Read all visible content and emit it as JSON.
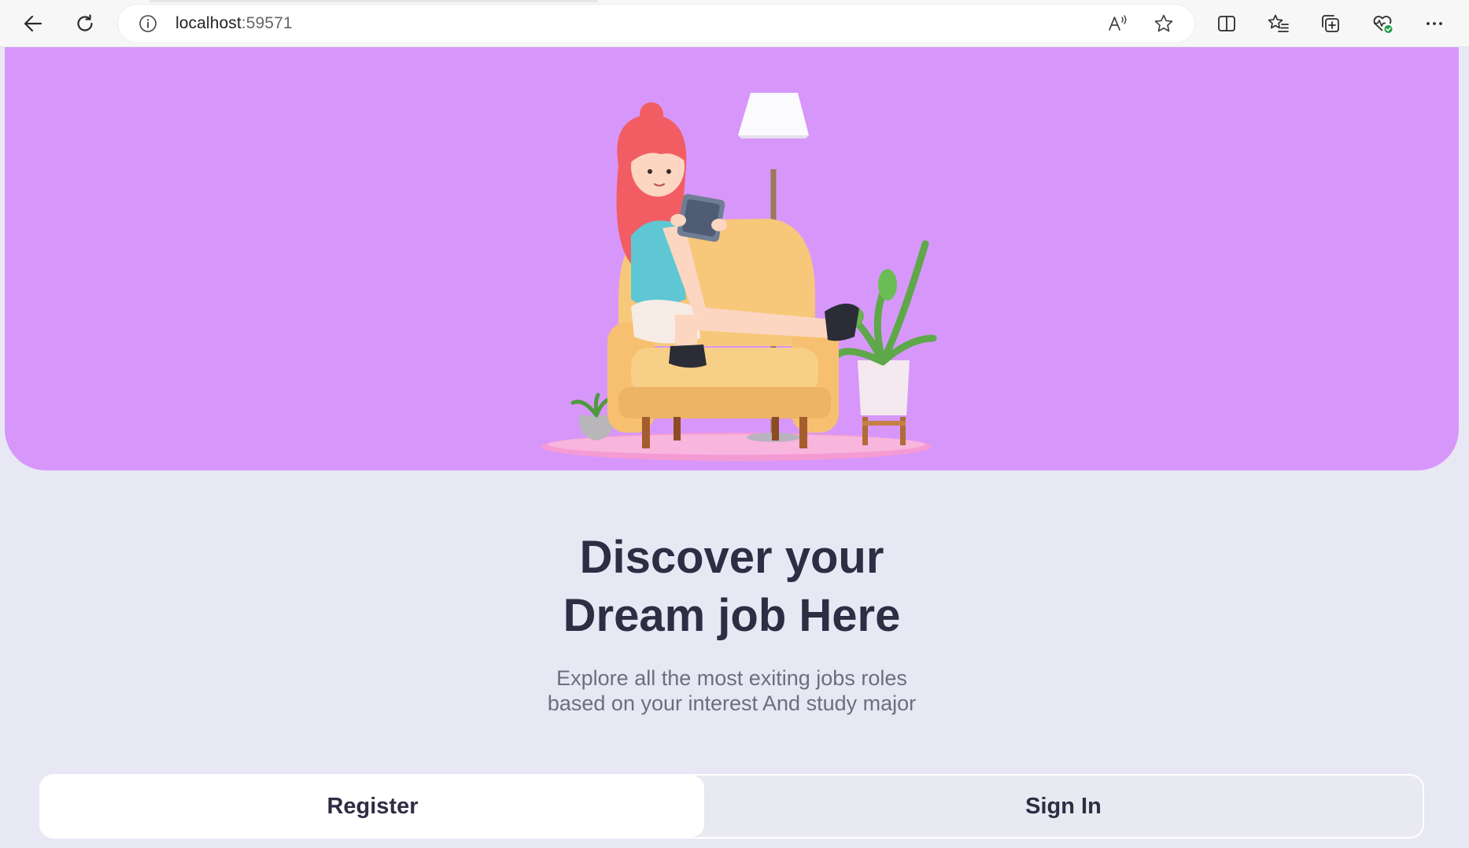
{
  "browser": {
    "url_host": "localhost",
    "url_port": ":59571",
    "icons": {
      "back": "back-arrow-icon",
      "reload": "reload-icon",
      "site_info": "info-icon",
      "read_aloud": "read-aloud-icon",
      "favorite": "star-icon",
      "split_screen": "split-screen-icon",
      "favorites": "favorites-list-icon",
      "collections": "collections-icon",
      "health": "browser-essentials-icon",
      "menu": "more-icon"
    }
  },
  "hero": {
    "background_color": "#d797fa",
    "illustration": "girl-on-armchair-with-tablet"
  },
  "headline": {
    "line1": "Discover your",
    "line2": "Dream job Here"
  },
  "subtitle": {
    "line1": "Explore all the most exiting jobs roles",
    "line2": "based on your interest And study major"
  },
  "auth": {
    "register_label": "Register",
    "signin_label": "Sign In",
    "selected": "Register"
  },
  "colors": {
    "page_background": "#e8e8f5",
    "text_dark": "#2f2d44",
    "text_muted": "#6e6d7c"
  }
}
